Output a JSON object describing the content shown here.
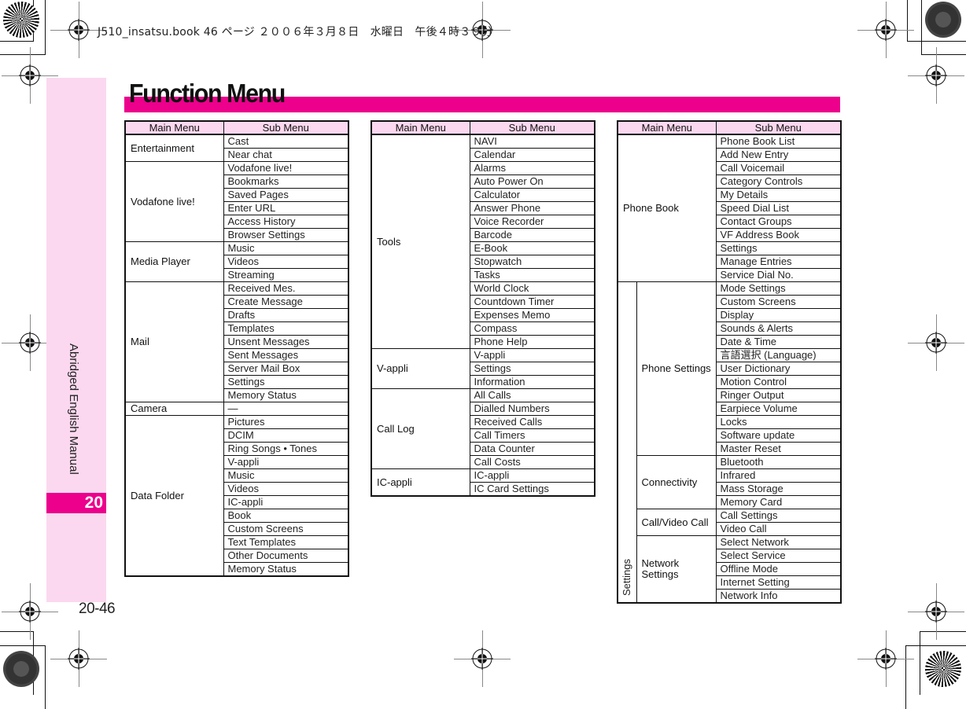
{
  "print_header": "J510_insatsu.book  46 ページ  ２００６年３月８日　水曜日　午後４時３９分",
  "side": {
    "label": "Abridged English Manual",
    "chapter": "20",
    "page_number": "20-46"
  },
  "title": "Function Menu",
  "colors": {
    "accent": "#ec008c",
    "header_fill": "#fbd8ef"
  },
  "headers": {
    "main": "Main Menu",
    "sub": "Sub Menu"
  },
  "table1": [
    {
      "main": "Entertainment",
      "subs": [
        "Cast",
        "Near chat"
      ]
    },
    {
      "main": "Vodafone live!",
      "subs": [
        "Vodafone live!",
        "Bookmarks",
        "Saved Pages",
        "Enter URL",
        "Access History",
        "Browser Settings"
      ]
    },
    {
      "main": "Media Player",
      "subs": [
        "Music",
        "Videos",
        "Streaming"
      ]
    },
    {
      "main": "Mail",
      "subs": [
        "Received Mes.",
        "Create Message",
        "Drafts",
        "Templates",
        "Unsent Messages",
        "Sent Messages",
        "Server Mail Box",
        "Settings",
        "Memory Status"
      ]
    },
    {
      "main": "Camera",
      "subs": [
        "—"
      ]
    },
    {
      "main": "Data Folder",
      "subs": [
        "Pictures",
        "DCIM",
        "Ring Songs • Tones",
        "V-appli",
        "Music",
        "Videos",
        "IC-appli",
        "Book",
        "Custom Screens",
        "Text Templates",
        "Other Documents",
        "Memory Status"
      ]
    }
  ],
  "table2": [
    {
      "main": "Tools",
      "subs": [
        "NAVI",
        "Calendar",
        "Alarms",
        "Auto Power On",
        "Calculator",
        "Answer Phone",
        "Voice Recorder",
        "Barcode",
        "E-Book",
        "Stopwatch",
        "Tasks",
        "World Clock",
        "Countdown Timer",
        "Expenses Memo",
        "Compass",
        "Phone Help"
      ]
    },
    {
      "main": "V-appli",
      "subs": [
        "V-appli",
        "Settings",
        "Information"
      ]
    },
    {
      "main": "Call Log",
      "subs": [
        "All Calls",
        "Dialled Numbers",
        "Received Calls",
        "Call Timers",
        "Data Counter",
        "Call Costs"
      ]
    },
    {
      "main": "IC-appli",
      "subs": [
        "IC-appli",
        "IC Card Settings"
      ]
    }
  ],
  "table3": {
    "phone_book": {
      "main": "Phone Book",
      "subs": [
        "Phone Book List",
        "Add New Entry",
        "Call Voicemail",
        "Category Controls",
        "My Details",
        "Speed Dial List",
        "Contact Groups",
        "VF Address Book",
        "Settings",
        "Manage Entries",
        "Service Dial No."
      ]
    },
    "settings": {
      "main": "Settings",
      "groups": [
        {
          "name": "Phone Settings",
          "subs": [
            "Mode Settings",
            "Custom Screens",
            "Display",
            "Sounds & Alerts",
            "Date & Time",
            "言語選択 (Language)",
            "User Dictionary",
            "Motion Control",
            "Ringer Output",
            "Earpiece Volume",
            "Locks",
            "Software update",
            "Master Reset"
          ]
        },
        {
          "name": "Connectivity",
          "subs": [
            "Bluetooth",
            "Infrared",
            "Mass Storage",
            "Memory Card"
          ]
        },
        {
          "name": "Call/Video Call",
          "subs": [
            "Call Settings",
            "Video Call"
          ]
        },
        {
          "name": "Network Settings",
          "subs": [
            "Select Network",
            "Select Service",
            "Offline Mode",
            "Internet Setting",
            "Network Info"
          ]
        }
      ]
    }
  }
}
